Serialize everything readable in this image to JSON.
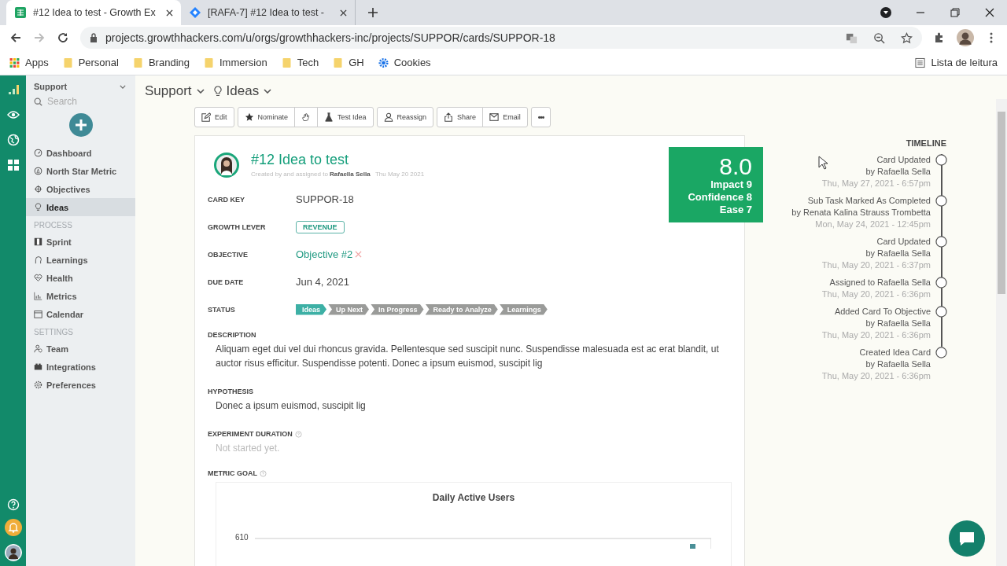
{
  "browser": {
    "tabs": [
      {
        "title": "#12 Idea to test - Growth Ex",
        "selected": true,
        "kind": "sheet"
      },
      {
        "title": "[RAFA-7] #12 Idea to test -",
        "selected": false,
        "kind": "diamond"
      }
    ],
    "url": "projects.growthhackers.com/u/orgs/growthhackers-inc/projects/SUPPOR/cards/SUPPOR-18",
    "bookmarks": [
      {
        "label": "Apps",
        "kind": "apps"
      },
      {
        "label": "Personal",
        "kind": "folder"
      },
      {
        "label": "Branding",
        "kind": "folder"
      },
      {
        "label": "Immersion",
        "kind": "folder"
      },
      {
        "label": "Tech",
        "kind": "folder"
      },
      {
        "label": "GH",
        "kind": "folder"
      },
      {
        "label": "Cookies",
        "kind": "gear"
      }
    ],
    "reading_list": "Lista de leitura"
  },
  "sidebar": {
    "project": "Support",
    "search_placeholder": "Search",
    "sections": [
      {
        "items": [
          {
            "label": "Dashboard",
            "selected": false
          },
          {
            "label": "North Star Metric",
            "selected": false
          },
          {
            "label": "Objectives",
            "selected": false
          },
          {
            "label": "Ideas",
            "selected": true
          }
        ]
      },
      {
        "heading": "PROCESS",
        "items": [
          {
            "label": "Sprint",
            "selected": false
          },
          {
            "label": "Learnings",
            "selected": false
          },
          {
            "label": "Health",
            "selected": false
          },
          {
            "label": "Metrics",
            "selected": false
          },
          {
            "label": "Calendar",
            "selected": false
          }
        ]
      },
      {
        "heading": "SETTINGS",
        "items": [
          {
            "label": "Team",
            "selected": false
          },
          {
            "label": "Integrations",
            "selected": false
          },
          {
            "label": "Preferences",
            "selected": false
          }
        ]
      }
    ]
  },
  "breadcrumb": {
    "project": "Support",
    "view": "Ideas"
  },
  "toolbar": [
    {
      "label": "Edit"
    },
    {
      "label": "Nominate"
    },
    {
      "label": "Test Idea"
    },
    {
      "label": "Reassign"
    },
    {
      "label": "Share"
    },
    {
      "label": "Email"
    },
    {
      "label": "•••"
    }
  ],
  "card": {
    "title": "#12 Idea to test",
    "created_prefix": "Created by and assigned to",
    "owner": "Rafaella Sella",
    "created_date": "Thu May 20 2021",
    "score": {
      "total": "8.0",
      "lines": [
        "Impact 9",
        "Confidence 8",
        "Ease 7"
      ]
    },
    "fields": [
      {
        "label": "CARD KEY",
        "kind": "text",
        "value": "SUPPOR-18"
      },
      {
        "label": "GROWTH LEVER",
        "kind": "tag",
        "value": "REVENUE"
      },
      {
        "label": "OBJECTIVE",
        "kind": "link",
        "value": "Objective #2"
      },
      {
        "label": "DUE DATE",
        "kind": "text",
        "value": "Jun 4, 2021"
      },
      {
        "label": "STATUS",
        "kind": "pipeline"
      }
    ],
    "status": [
      {
        "label": "Ideas",
        "selected": true
      },
      {
        "label": "Up Next",
        "selected": false
      },
      {
        "label": "In Progress",
        "selected": false
      },
      {
        "label": "Ready to Analyze",
        "selected": false
      },
      {
        "label": "Learnings",
        "selected": false
      }
    ],
    "description_label": "DESCRIPTION",
    "description": "Aliquam eget dui vel dui rhoncus gravida. Pellentesque sed suscipit nunc. Suspendisse malesuada est ac erat blandit, ut auctor risus efficitur. Suspendisse potenti. Donec a ipsum euismod, suscipit lig",
    "hypothesis_label": "HYPOTHESIS",
    "hypothesis": "Donec a ipsum euismod, suscipit lig",
    "duration_label": "EXPERIMENT DURATION",
    "duration": "Not started yet.",
    "metric_label": "METRIC GOAL",
    "chart_title": "Daily Active Users",
    "chart_tick": "610"
  },
  "timeline": {
    "heading": "TIMELINE",
    "events": [
      {
        "title": "Card Updated",
        "by": "by Rafaella Sella",
        "time": "Thu, May 27, 2021 - 6:57pm"
      },
      {
        "title": "Sub Task Marked As Completed",
        "by": "by Renata Kalina Strauss Trombetta",
        "time": "Mon, May 24, 2021 - 12:45pm"
      },
      {
        "title": "Card Updated",
        "by": "by Rafaella Sella",
        "time": "Thu, May 20, 2021 - 6:37pm"
      },
      {
        "title": "Assigned to Rafaella Sella",
        "time": "Thu, May 20, 2021 - 6:36pm"
      },
      {
        "title": "Added Card To Objective",
        "by": "by Rafaella Sella",
        "time": "Thu, May 20, 2021 - 6:36pm"
      },
      {
        "title": "Created Idea Card",
        "by": "by Rafaella Sella",
        "time": "Thu, May 20, 2021 - 6:36pm"
      }
    ]
  }
}
